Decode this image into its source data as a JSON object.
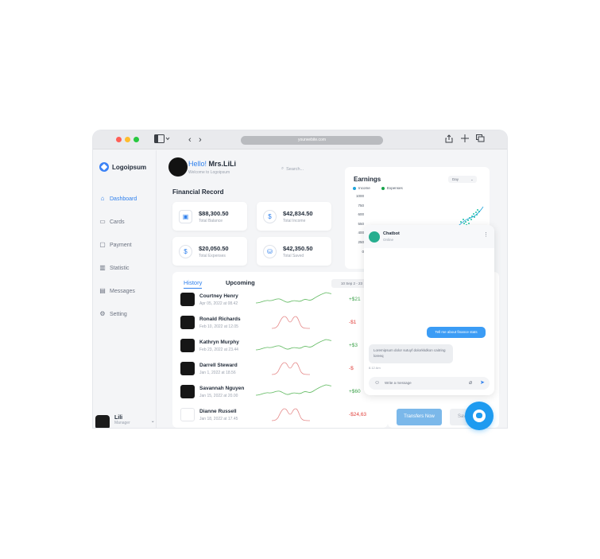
{
  "browser": {
    "url": "yourwebite.com",
    "dots": [
      "#ff5f57",
      "#febc2e",
      "#28c840"
    ]
  },
  "sidebar": {
    "logo": "Logoipsum",
    "items": [
      {
        "label": "Dashboard",
        "icon": "home-icon",
        "active": true
      },
      {
        "label": "Cards",
        "icon": "card-icon",
        "active": false
      },
      {
        "label": "Payment",
        "icon": "payment-icon",
        "active": false
      },
      {
        "label": "Statistic",
        "icon": "chart-icon",
        "active": false
      },
      {
        "label": "Messages",
        "icon": "message-icon",
        "active": false
      },
      {
        "label": "Setting",
        "icon": "gear-icon",
        "active": false
      }
    ],
    "user": {
      "name": "Lili",
      "role": "Manager"
    }
  },
  "header": {
    "hello": "Hello!",
    "name": "Mrs.LiLi",
    "welcome": "Welcome to Logoipsum",
    "search_placeholder": "Search..."
  },
  "financial": {
    "title": "Financial Record",
    "cards": [
      {
        "value": "$88,300.50",
        "label": "Total Balance",
        "icon": "wallet-icon"
      },
      {
        "value": "$42,834.50",
        "label": "Total Income",
        "icon": "income-icon"
      },
      {
        "value": "$20,050.50",
        "label": "Total Expenses",
        "icon": "expense-icon"
      },
      {
        "value": "$42,350.50",
        "label": "Total Saved",
        "icon": "savings-icon"
      }
    ]
  },
  "history": {
    "tabs": [
      "History",
      "Upcoming"
    ],
    "date_range": "10 Sep 2 - 23",
    "rows": [
      {
        "name": "Courtney Henry",
        "date": "Apr 05, 2022 at 08.42",
        "amount": "+$21",
        "type": "pos"
      },
      {
        "name": "Ronald Richards",
        "date": "Feb 10, 2022 at 12.05",
        "amount": "-$1",
        "type": "neg"
      },
      {
        "name": "Kathryn Murphy",
        "date": "Feb 23, 2022 at 23.44",
        "amount": "+$3",
        "type": "pos"
      },
      {
        "name": "Darrell Steward",
        "date": "Jan 1, 2022 at 18.56",
        "amount": "-$",
        "type": "neg"
      },
      {
        "name": "Savannah Nguyen",
        "date": "Jan 15, 2022 at 20.00",
        "amount": "+$60",
        "type": "pos"
      },
      {
        "name": "Dianne Russell",
        "date": "Jan 18, 2022 at 17.45",
        "amount": "-$24,63",
        "type": "neg"
      }
    ]
  },
  "earnings": {
    "title": "Earnings",
    "legend": [
      {
        "label": "Income",
        "color": "#1fa4d9"
      },
      {
        "label": "Expenses",
        "color": "#16a34a"
      }
    ],
    "period": "Day",
    "y_ticks": [
      "1000",
      "750",
      "600",
      "550",
      "400",
      "250",
      "0"
    ]
  },
  "transfer": {
    "button": "Transfers Now",
    "secondary": "Sav"
  },
  "chat": {
    "title": "Chatbot",
    "status": "Online",
    "user_message": "Tell me about finance stats",
    "bot_message": "Loremipsum dolor sutuyf dolorkkdkon caitring loreeq",
    "bot_time": "8.12 Am",
    "input_placeholder": "Write a message"
  }
}
